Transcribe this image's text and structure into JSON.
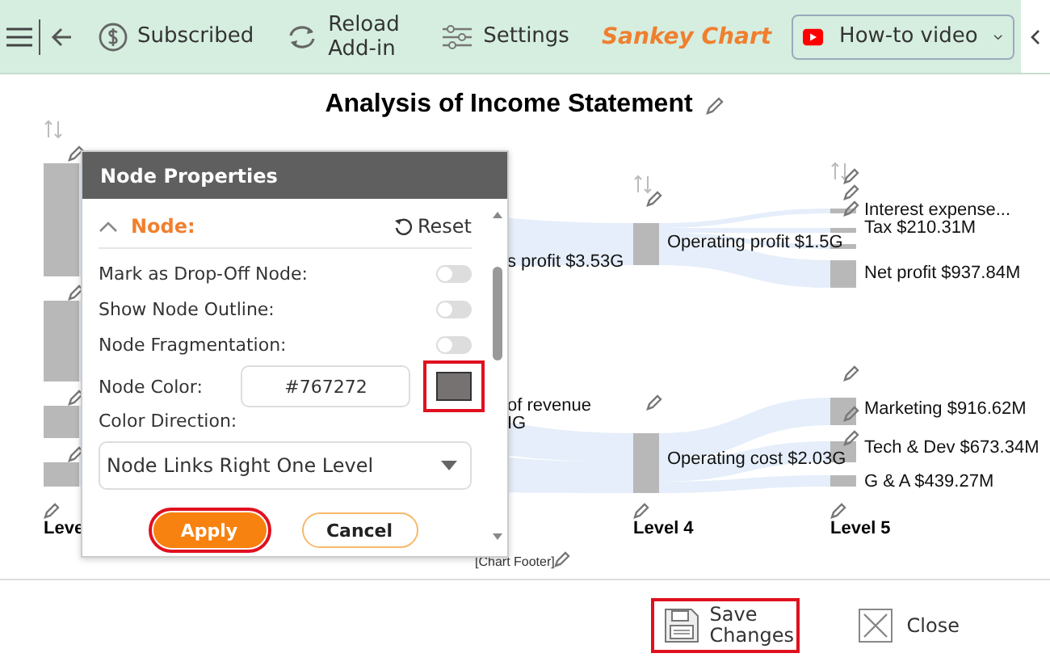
{
  "toolbar": {
    "items": [
      {
        "kind": "subscribed",
        "label": "Subscribed"
      },
      {
        "kind": "reload",
        "label": "Reload Add-in"
      },
      {
        "kind": "settings",
        "label": "Settings"
      }
    ],
    "app_title": "Sankey Chart",
    "video_button": "How-to video"
  },
  "chart": {
    "title": "Analysis of Income Statement",
    "labels": [
      {
        "text": "s profit $3.53G"
      },
      {
        "text": "of revenue"
      },
      {
        "text": "IG"
      },
      {
        "text": "Operating profit $1.5G"
      },
      {
        "text": "Operating cost $2.03G"
      },
      {
        "text": "Interest expense..."
      },
      {
        "text": "Tax $210.31M"
      },
      {
        "text": "Net profit $937.84M"
      },
      {
        "text": "Marketing $916.62M"
      },
      {
        "text": "Tech & Dev $673.34M"
      },
      {
        "text": "G & A $439.27M"
      }
    ],
    "levels": [
      "Leve",
      "Level 4",
      "Level 5"
    ],
    "footer": "[Chart Footer]"
  },
  "dialog": {
    "title": "Node Properties",
    "section": "Node:",
    "expanded": true,
    "reset": "Reset",
    "toggles": [
      {
        "label": "Mark as Drop-Off Node:",
        "on": false
      },
      {
        "label": "Show Node Outline:",
        "on": false
      },
      {
        "label": "Node Fragmentation:",
        "on": false
      }
    ],
    "color_label": "Node Color:",
    "color_value": "#767272",
    "color": "#767272",
    "direction_label": "Color Direction:",
    "direction": "Node Links Right One Level",
    "apply": "Apply",
    "cancel": "Cancel"
  },
  "footer": {
    "save": "Save Changes",
    "close": "Close"
  }
}
